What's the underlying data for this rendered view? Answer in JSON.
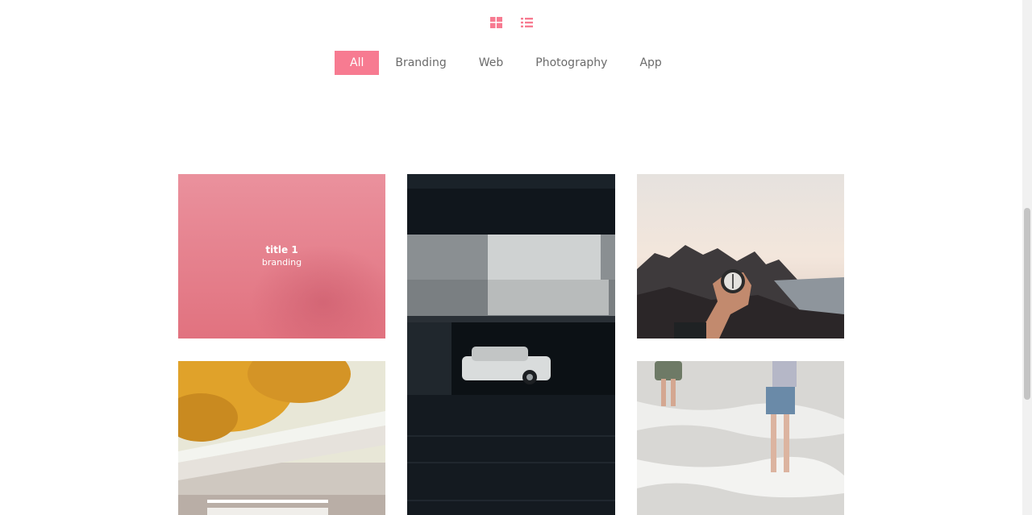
{
  "view_toggle": {
    "grid_icon": "grid-icon",
    "list_icon": "list-icon",
    "accent_color": "#f77b91"
  },
  "filters": [
    {
      "label": "All",
      "active": true
    },
    {
      "label": "Branding"
    },
    {
      "label": "Web"
    },
    {
      "label": "Photography"
    },
    {
      "label": "App"
    }
  ],
  "portfolio": {
    "items": [
      {
        "title": "title 1",
        "category": "branding",
        "image": "pink abstract",
        "hovered": true
      },
      {
        "image": "dark parking garage with white car"
      },
      {
        "image": "hand holding compass at mountain sunset"
      },
      {
        "image": "autumn tree over white building"
      },
      {
        "image": "people walking in shallow sea waves"
      }
    ]
  }
}
